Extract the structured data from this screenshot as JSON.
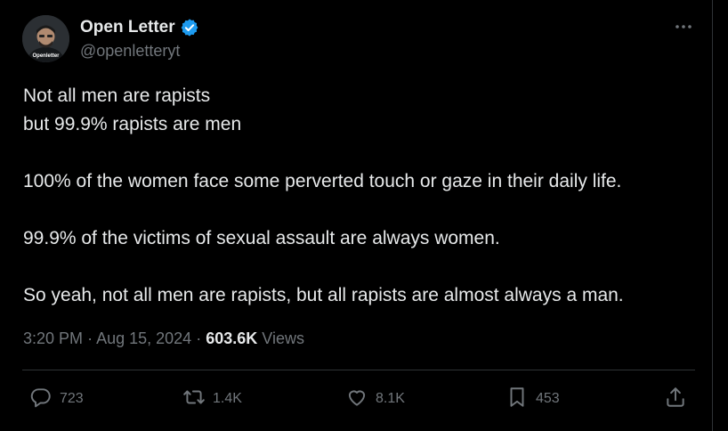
{
  "author": {
    "name": "Open Letter",
    "handle": "@openletteryt",
    "avatar_caption": "Openletter"
  },
  "tweet": {
    "lines": [
      "Not all men are rapists",
      "but 99.9% rapists are men",
      "",
      "100% of the women face some perverted touch or gaze in their daily life.",
      "",
      "99.9% of the victims of sexual assault are always women.",
      "",
      "So yeah, not all men are rapists, but all rapists are almost always a man."
    ]
  },
  "meta": {
    "time": "3:20 PM",
    "sep1": "·",
    "date": "Aug 15, 2024",
    "sep2": "·",
    "views_count": "603.6K",
    "views_label": "Views"
  },
  "actions": {
    "replies": "723",
    "reposts": "1.4K",
    "likes": "8.1K",
    "bookmarks": "453"
  },
  "colors": {
    "background": "#000000",
    "text": "#e7e9ea",
    "muted": "#71767b",
    "verified": "#1d9bf0"
  },
  "icons": [
    "verified-badge-icon",
    "more-icon",
    "reply-icon",
    "repost-icon",
    "like-icon",
    "bookmark-icon",
    "share-icon"
  ]
}
